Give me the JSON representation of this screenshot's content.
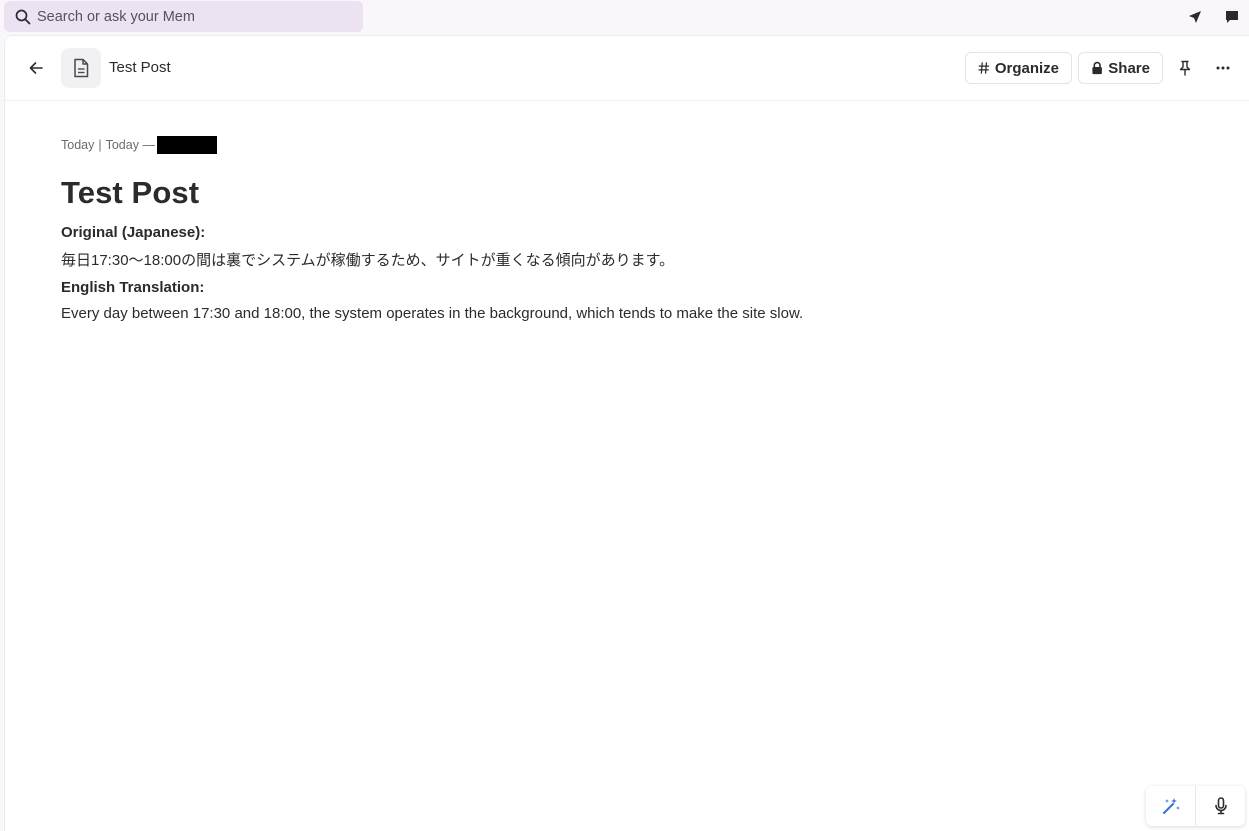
{
  "search": {
    "placeholder": "Search or ask your Mem"
  },
  "topbar": {
    "icons": [
      "navigate-arrow-icon",
      "chat-icon"
    ]
  },
  "header": {
    "doc_title": "Test Post",
    "organize_label": "Organize",
    "share_label": "Share"
  },
  "note": {
    "meta_created": "Today",
    "meta_separator": "|",
    "meta_updated": "Today —",
    "title": "Test Post",
    "original_heading": "Original (Japanese):",
    "original_text": "毎日17:30〜18:00の間は裏でシステムが稼働するため、サイトが重くなる傾向があります。",
    "translation_heading": "English Translation:",
    "translation_text": "Every day between 17:30 and 18:00, the system operates in the background, which tends to make the site slow."
  },
  "colors": {
    "accent": "#3b6fd9",
    "search_bg": "#ebe3f1"
  }
}
